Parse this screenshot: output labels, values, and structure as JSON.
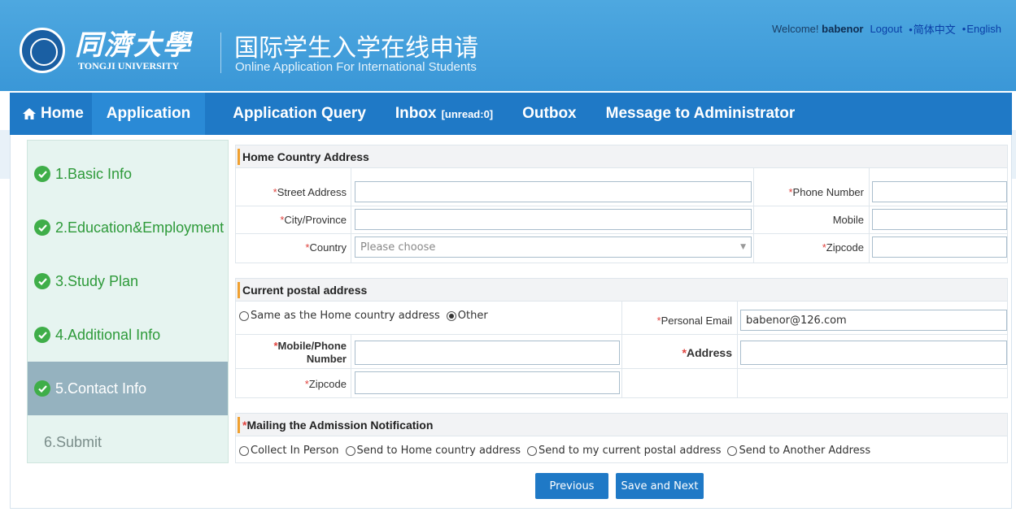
{
  "header": {
    "logo_cn": "同濟大學",
    "logo_en": "TONGJI UNIVERSITY",
    "title_cn": "国际学生入学在线申请",
    "title_en": "Online Application For International Students",
    "welcome": "Welcome!",
    "username": "babenor",
    "logout": "Logout",
    "lang_cn": "简体中文",
    "lang_en": "English"
  },
  "nav": {
    "home": "Home",
    "application": "Application",
    "query": "Application Query",
    "inbox": "Inbox",
    "inbox_unread": "[unread:0]",
    "outbox": "Outbox",
    "message": "Message to Administrator"
  },
  "sidebar": {
    "steps": [
      {
        "label": "1.Basic Info",
        "state": "done"
      },
      {
        "label": "2.Education&Employment",
        "state": "done"
      },
      {
        "label": "3.Study Plan",
        "state": "done"
      },
      {
        "label": "4.Additional Info",
        "state": "done"
      },
      {
        "label": "5.Contact Info",
        "state": "active"
      },
      {
        "label": "6.Submit",
        "state": "pending"
      }
    ]
  },
  "home_address": {
    "title": "Home Country Address",
    "street_label": "Street Address",
    "city_label": "City/Province",
    "country_label": "Country",
    "country_placeholder": "Please choose",
    "phone_label": "Phone Number",
    "mobile_label": "Mobile",
    "zipcode_label": "Zipcode",
    "required_mark": "*"
  },
  "postal_address": {
    "title": "Current postal address",
    "same_option": "Same as the Home country address",
    "other_option": "Other",
    "selected": "Other",
    "email_label": "Personal Email",
    "email_value": "babenor@126.com",
    "mobile_label_1": "Mobile/Phone",
    "mobile_label_2": "Number",
    "address_label": "Address",
    "zipcode_label": "Zipcode"
  },
  "mailing": {
    "title": "Mailing the Admission Notification",
    "options": [
      "Collect In Person",
      "Send to Home country address",
      "Send to my current postal address",
      "Send to Another Address"
    ]
  },
  "buttons": {
    "previous": "Previous",
    "save_next": "Save and Next"
  },
  "colors": {
    "header": "#3a97d7",
    "nav": "#1f79c6",
    "nav_active": "#2a8ad6",
    "step_done": "#2e9a3a",
    "step_active_bg": "#95b2bf",
    "required": "#e0433e"
  }
}
